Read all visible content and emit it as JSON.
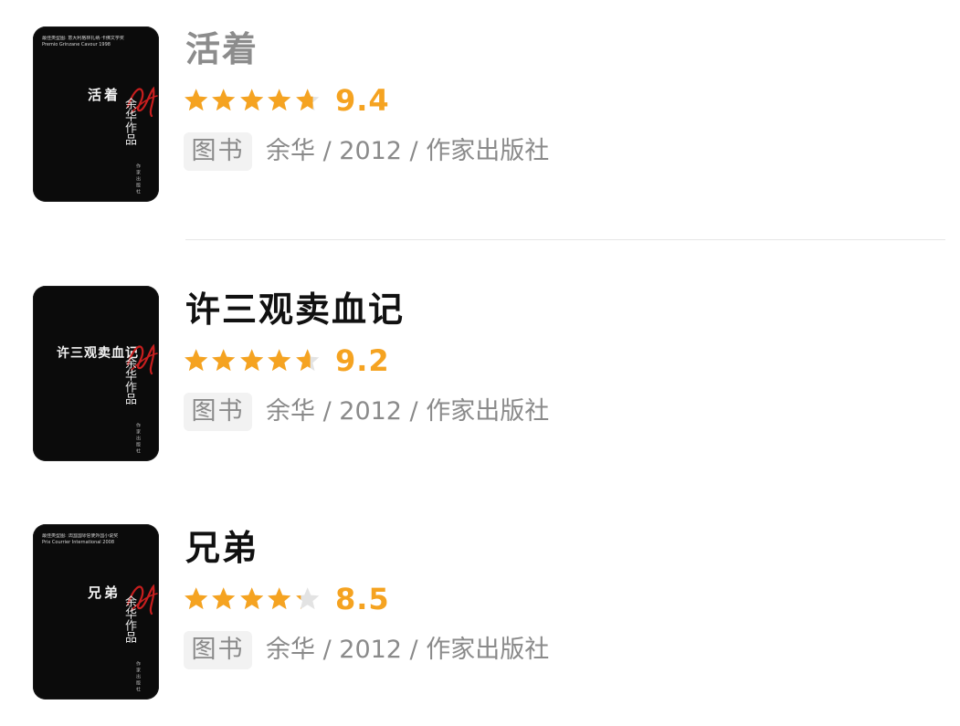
{
  "books": [
    {
      "title": "活着",
      "cover_series": "最佳类型图: 意大利格林扎纳·卡佛文学奖",
      "cover_series_sub": "Premio Grinzane Cavour 1998",
      "cover_title": "活着",
      "cover_author": "余华作品",
      "cover_publisher": "作家出版社",
      "rating_fraction": 0.94,
      "rating_value": "9.4",
      "tag": "图书",
      "meta": "余华 / 2012 / 作家出版社"
    },
    {
      "title": "许三观卖血记",
      "cover_series": "",
      "cover_series_sub": "",
      "cover_title": "许三观卖血记",
      "cover_author": "余华作品",
      "cover_publisher": "作家出版社",
      "rating_fraction": 0.92,
      "rating_value": "9.2",
      "tag": "图书",
      "meta": "余华 / 2012 / 作家出版社"
    },
    {
      "title": "兄弟",
      "cover_series": "最佳类型图: 法国国际信使外国小说奖",
      "cover_series_sub": "Prix Courrier International 2008",
      "cover_title": "兄弟",
      "cover_author": "余华作品",
      "cover_publisher": "作家出版社",
      "rating_fraction": 0.85,
      "rating_value": "8.5",
      "tag": "图书",
      "meta": "余华 / 2012 / 作家出版社"
    }
  ],
  "colors": {
    "star": "#f5a321",
    "star_empty": "#e3e3e3",
    "signature": "#c81e1e"
  },
  "icons": {
    "star": "star-icon",
    "signature": "author-signature"
  }
}
